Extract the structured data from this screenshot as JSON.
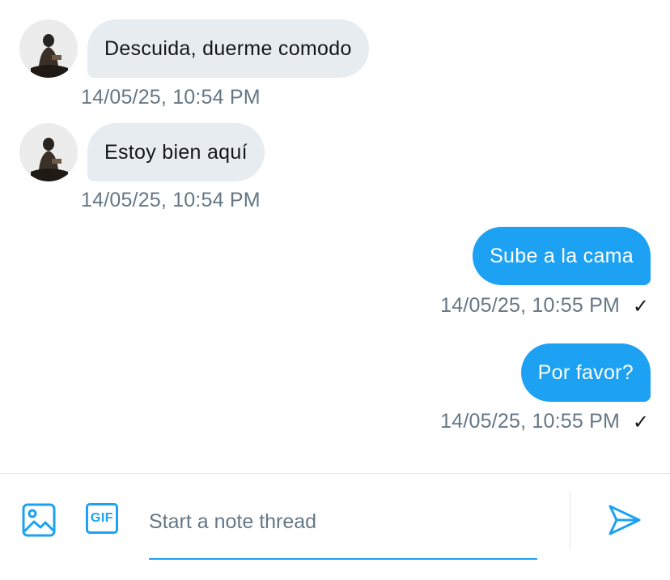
{
  "conversation": {
    "messages": [
      {
        "direction": "incoming",
        "text": "Descuida, duerme comodo",
        "timestamp": "14/05/25, 10:54 PM"
      },
      {
        "direction": "incoming",
        "text": "Estoy bien aquí",
        "timestamp": "14/05/25, 10:54 PM"
      },
      {
        "direction": "outgoing",
        "text": "Sube a la cama",
        "timestamp": "14/05/25, 10:55 PM",
        "status": "✓"
      },
      {
        "direction": "outgoing",
        "text": "Por favor?",
        "timestamp": "14/05/25, 10:55 PM",
        "status": "✓"
      }
    ]
  },
  "composer": {
    "media_icon": "image-icon",
    "gif_label": "GIF",
    "placeholder": "Start a note thread",
    "send_icon": "send-icon"
  },
  "colors": {
    "accent": "#1da1f2",
    "incoming_bubble": "#e6ecf0",
    "timestamp": "#657786"
  }
}
